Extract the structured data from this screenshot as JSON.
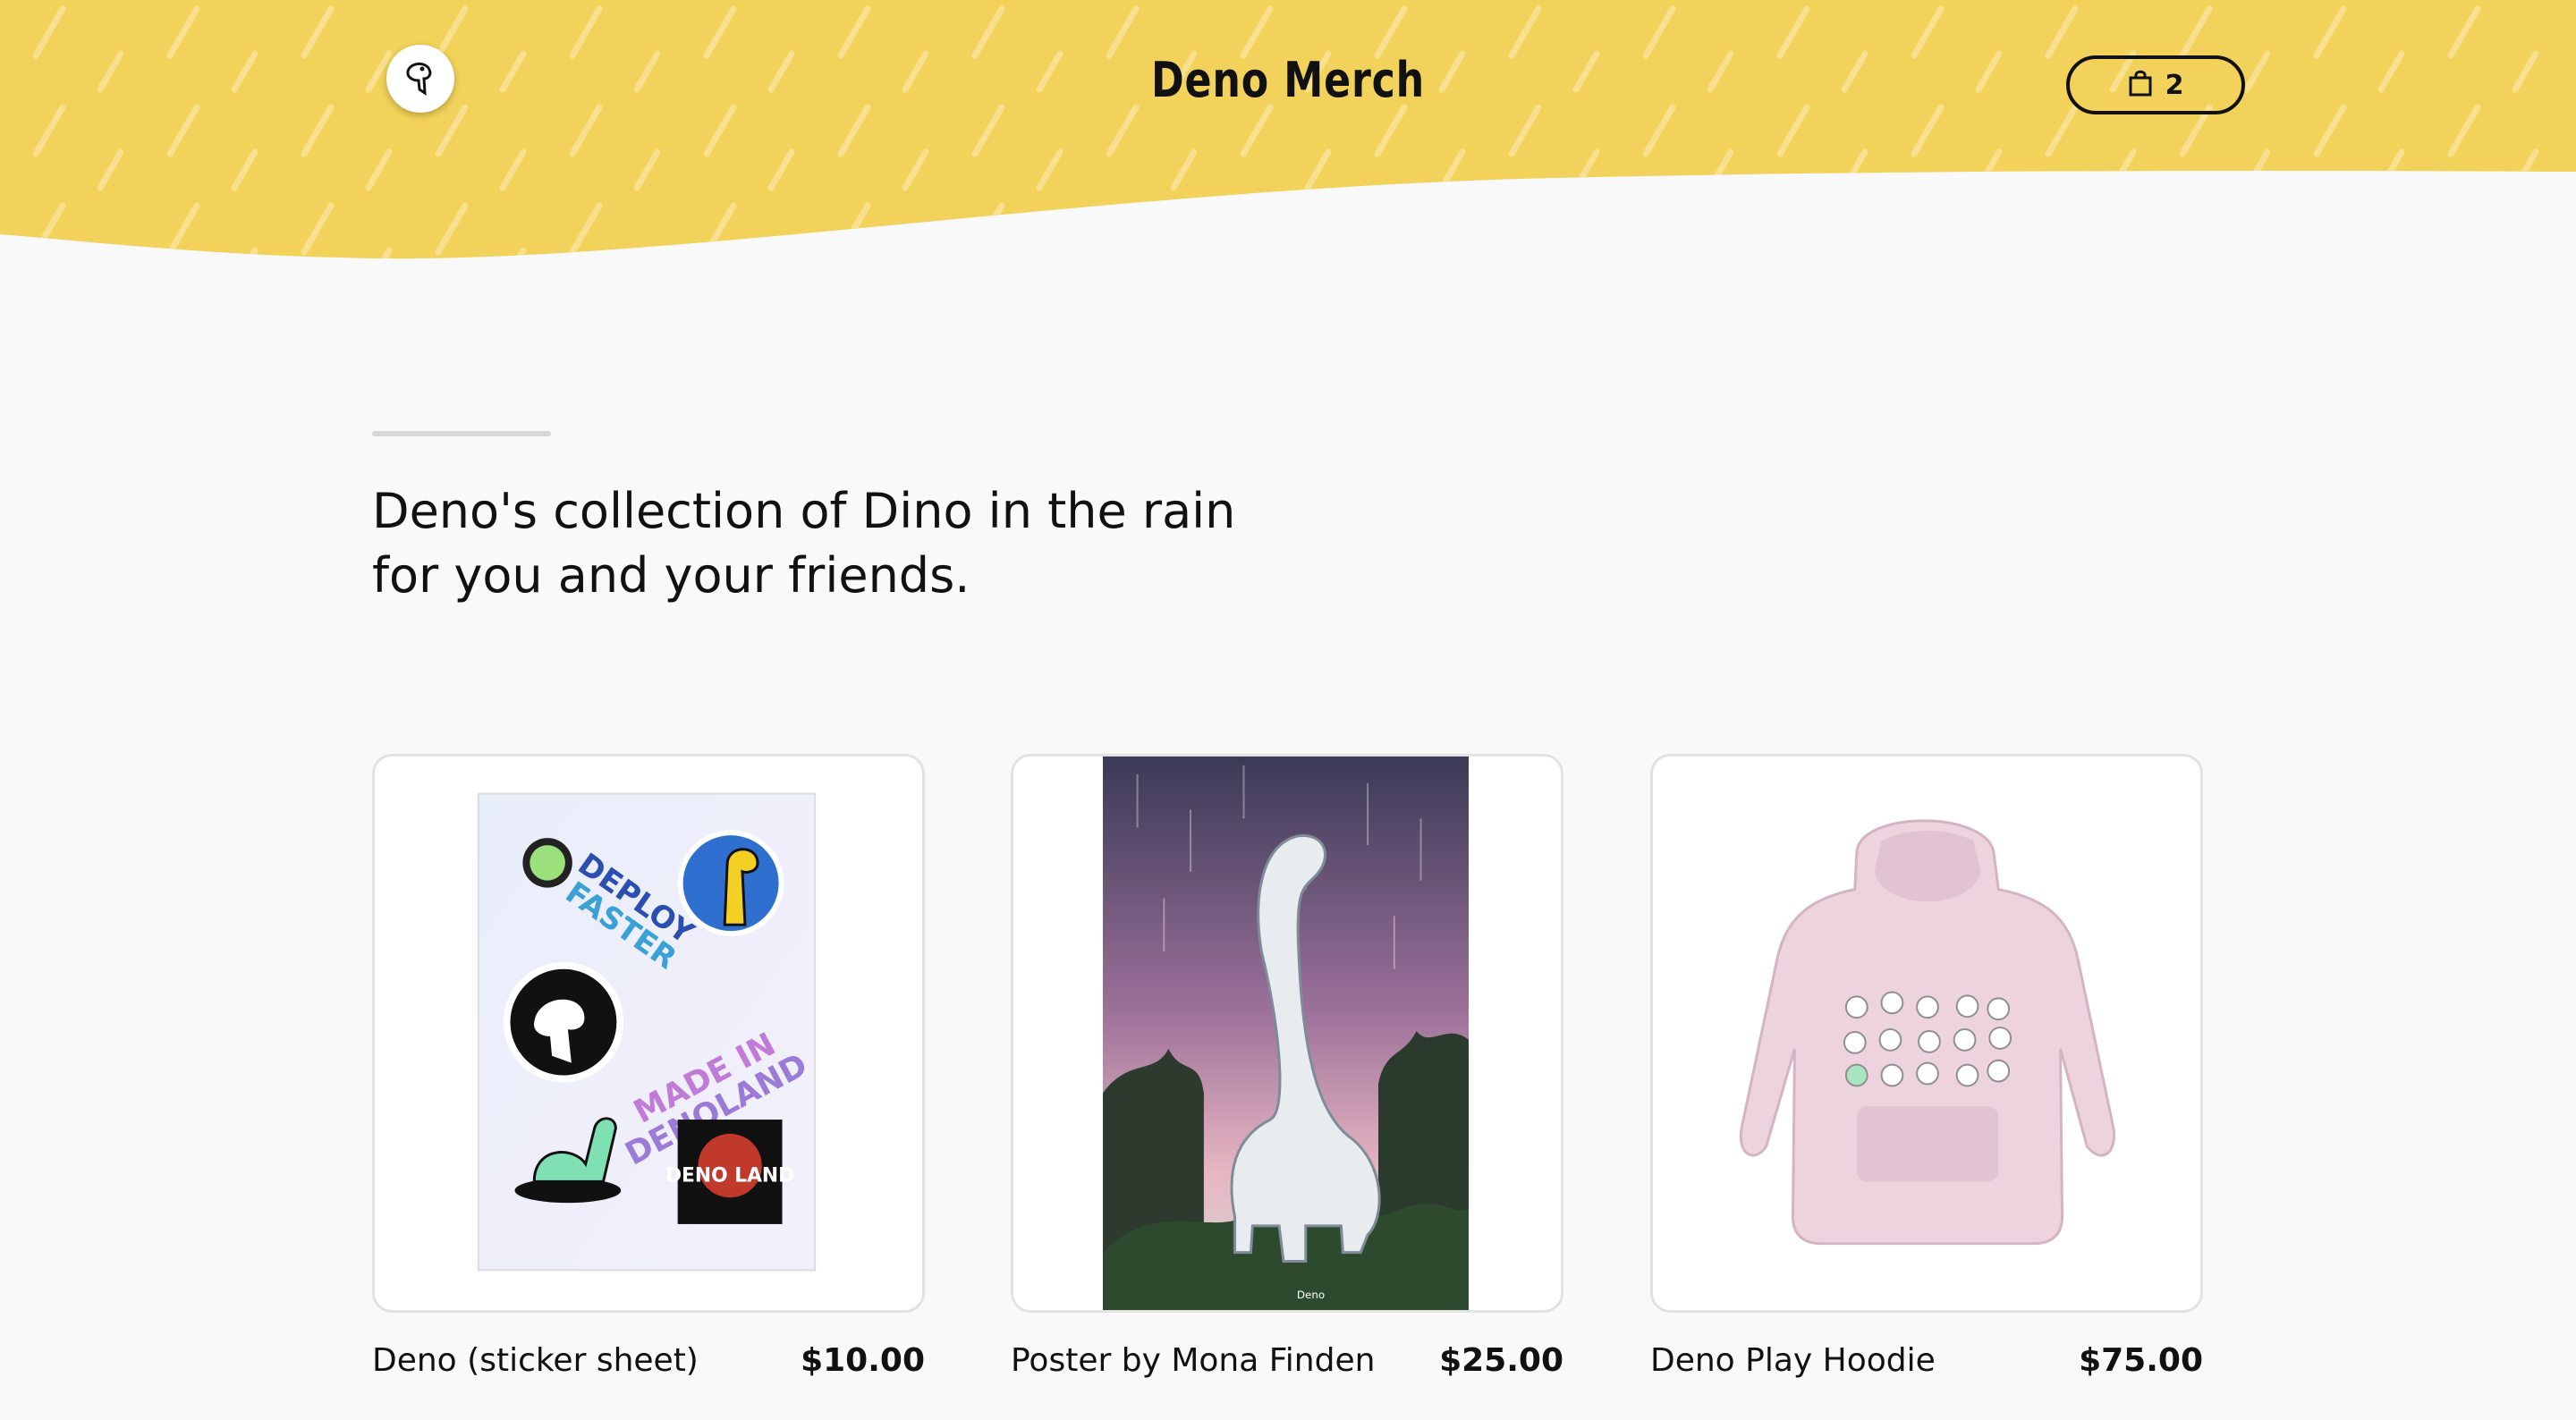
{
  "header": {
    "title": "Deno Merch",
    "logo_icon": "deno-logo-icon",
    "cart_icon": "shopping-bag-icon",
    "cart_count": "2",
    "accent": "#f2d25a"
  },
  "intro": {
    "line1": "Deno's collection of Dino in the rain",
    "line2": "for you and your friends."
  },
  "products": [
    {
      "name": "Deno (sticker sheet)",
      "price": "$10.00",
      "image": "sticker-sheet"
    },
    {
      "name": "Poster by Mona Finden",
      "price": "$25.00",
      "image": "dino-poster",
      "poster_mark": "Deno"
    },
    {
      "name": "Deno Play Hoodie",
      "price": "$75.00",
      "image": "pink-hoodie"
    }
  ],
  "stickers": {
    "deploy": "DEPLOY",
    "faster": "FASTER",
    "made_in": "MADE IN",
    "denoland": "DENOLAND",
    "deno_land": "DENO LAND"
  }
}
